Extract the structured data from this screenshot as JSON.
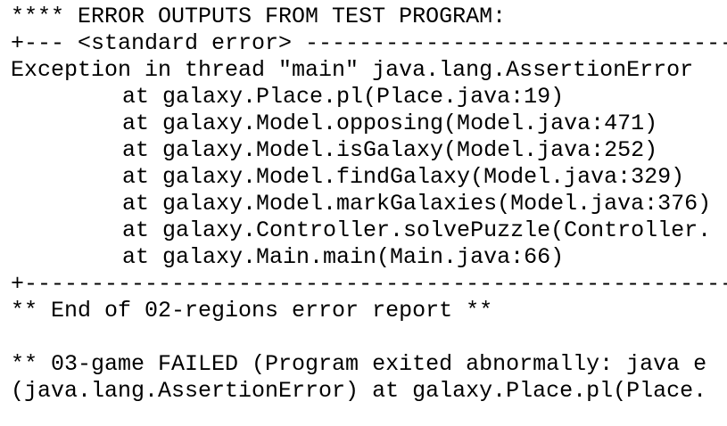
{
  "console": {
    "header": "**** ERROR OUTPUTS FROM TEST PROGRAM:",
    "stderr_open": "+--- <standard error> ---------------------------------------------",
    "exception": "Exception in thread \"main\" java.lang.AssertionError",
    "stack": [
      "at galaxy.Place.pl(Place.java:19)",
      "at galaxy.Model.opposing(Model.java:471)",
      "at galaxy.Model.isGalaxy(Model.java:252)",
      "at galaxy.Model.findGalaxy(Model.java:329)",
      "at galaxy.Model.markGalaxies(Model.java:376)",
      "at galaxy.Controller.solvePuzzle(Controller.",
      "at galaxy.Main.main(Main.java:66)"
    ],
    "stderr_close": "+-----------------------------------------------------------------",
    "end_report": "** End of 02-regions error report **",
    "failed_line": "** 03-game FAILED (Program exited abnormally: java e",
    "failed_detail": "(java.lang.AssertionError) at galaxy.Place.pl(Place."
  }
}
